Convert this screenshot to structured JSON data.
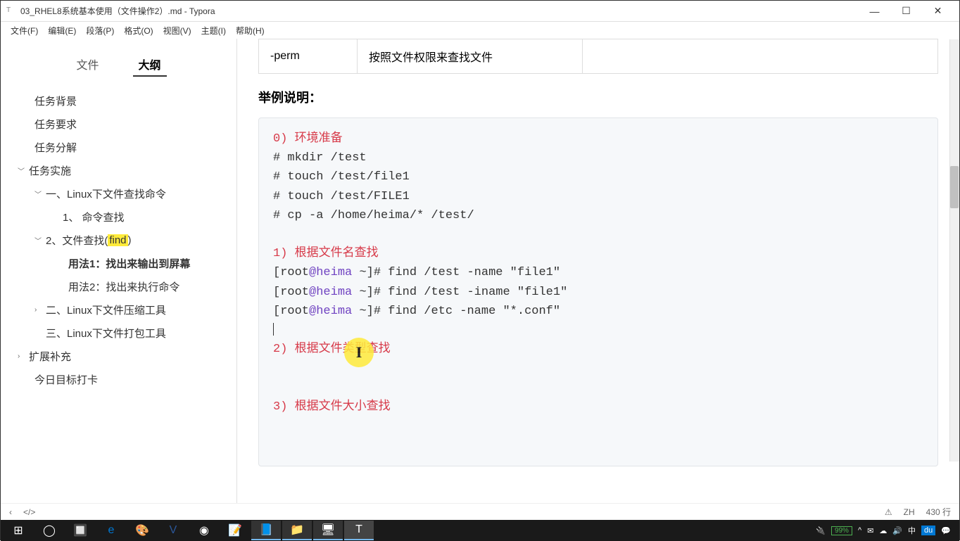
{
  "window": {
    "title": "03_RHEL8系统基本使用（文件操作2）.md - Typora"
  },
  "menu": {
    "file": "文件(F)",
    "edit": "编辑(E)",
    "paragraph": "段落(P)",
    "format": "格式(O)",
    "view": "视图(V)",
    "theme": "主题(I)",
    "help": "帮助(H)"
  },
  "sidebar": {
    "tab_files": "文件",
    "tab_outline": "大纲",
    "items": {
      "bg": "任务背景",
      "req": "任务要求",
      "break": "任务分解",
      "impl": "任务实施",
      "linux_find": "一、Linux下文件查找命令",
      "cmd_find": "1、 命令查找",
      "file_find_prefix": "2、文件查找(",
      "file_find_hl": "find",
      "file_find_suffix": ")",
      "usage1": "用法1：找出来输出到屏幕",
      "usage2": "用法2：找出来执行命令",
      "compress": "二、Linux下文件压缩工具",
      "archive": "三、Linux下文件打包工具",
      "extend": "扩展补充",
      "today": "今日目标打卡"
    }
  },
  "content": {
    "table": {
      "c1": "-perm",
      "c2": "按照文件权限来查找文件"
    },
    "section": "举例说明：",
    "code": {
      "l0a": "0)",
      "l0b": " 环境准备",
      "l1": "# mkdir /test",
      "l2": "# touch /test/file1",
      "l3": "# touch /test/FILE1",
      "l4": "# cp -a /home/heima/* /test/",
      "l5a": "1)",
      "l5b": " 根据文件名查找",
      "l6_open": "[root",
      "l6_at": "@heima ",
      "l6_tilde": "~",
      "l6_close": "]# ",
      "l6_cmd": "find /test -name \"file1\"",
      "l7_cmd": "find /test -iname \"file1\"",
      "l8_cmd": "find /etc -name \"*.conf\"",
      "l9a": "2)",
      "l9b": " 根据文件类型查找",
      "l10a": "3)",
      "l10b": " 根据文件大小查找"
    }
  },
  "status": {
    "warn": "⚠",
    "lang": "ZH",
    "lines": "430 行",
    "code": "</>"
  },
  "tray": {
    "battery": "99%",
    "ime1": "中",
    "ime2": "du"
  }
}
